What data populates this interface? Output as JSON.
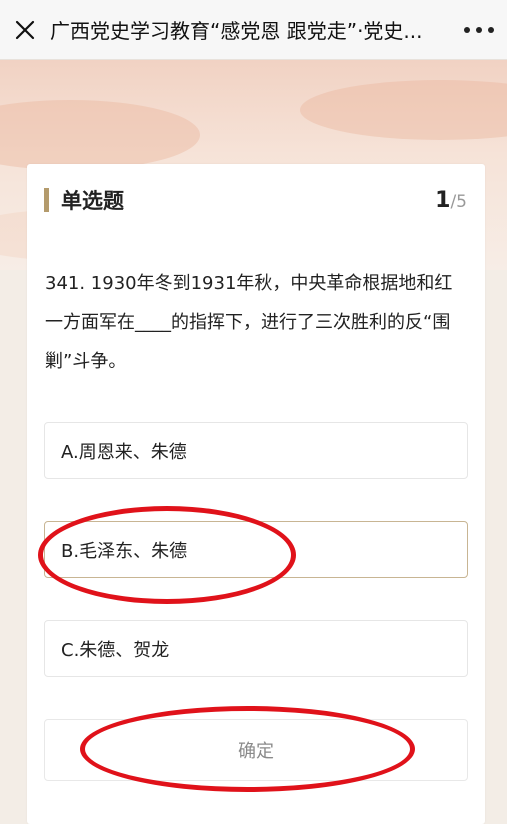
{
  "header": {
    "title": "广西党史学习教育“感党恩 跟党走”·党史...",
    "close_icon": "close-icon",
    "more_icon": "more-dots-icon"
  },
  "quiz": {
    "section_title": "单选题",
    "progress_current": "1",
    "progress_total": "/5",
    "question": "341. 1930年冬到1931年秋，中央革命根据地和红一方面军在____的指挥下，进行了三次胜利的反“围剿”斗争。",
    "options": [
      {
        "label": "A.周恩来、朱德",
        "selected": false
      },
      {
        "label": "B.毛泽东、朱德",
        "selected": true
      },
      {
        "label": "C.朱德、贺龙",
        "selected": false
      }
    ],
    "confirm_label": "确定"
  },
  "colors": {
    "accent_bar": "#b49b6c",
    "selected_border": "#c8b593",
    "annotation_red": "#e0121a"
  }
}
